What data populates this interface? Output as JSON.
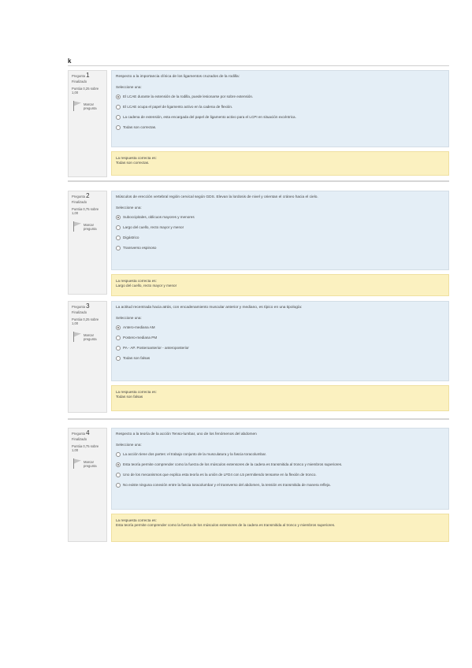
{
  "page_mark": "k",
  "flag_label": "Marcar pregunta",
  "prompt": "Seleccione una:",
  "questions": [
    {
      "label": "Pregunta",
      "number": "1",
      "state": "Finalizado",
      "grade": "Puntúa 0,25 sobre 1,00",
      "text": "Respecto a la importancia clínica de los ligamentos cruzados de la rodilla:",
      "options": [
        {
          "text": "El LCAE durante la extensión de la rodilla, puede lesionarse por sobre extensión.",
          "checked": true
        },
        {
          "text": "El LCAE ocupa el papel de ligamento activo en la cadena de flexión.",
          "checked": false
        },
        {
          "text": "La cadena de extensión, esta encargada del papel de ligamento activo para el LCPI en situación excéntrica.",
          "checked": false
        },
        {
          "text": "Todas son correctas.",
          "checked": false
        }
      ],
      "feedback_title": "La respuesta correcta es:",
      "feedback_answer": "Todas son correctas."
    },
    {
      "label": "Pregunta",
      "number": "2",
      "state": "Finalizado",
      "grade": "Puntúa 0,75 sobre 1,00",
      "text": "Músculos de erección vertebral región cervical según GDS. Elevan la lordosis de nivel y orientan el cráneo hacia el cielo.",
      "options": [
        {
          "text": "Suboccipitales, oblicuos mayores y menores",
          "checked": true
        },
        {
          "text": "Largo del cuello, recto mayor y menor",
          "checked": false
        },
        {
          "text": "Digástrico",
          "checked": false
        },
        {
          "text": "Transverso espinoso",
          "checked": false
        }
      ],
      "feedback_title": "La respuesta correcta es:",
      "feedback_answer": "Largo del cuello, recto mayor y menor"
    },
    {
      "label": "Pregunta",
      "number": "3",
      "state": "Finalizado",
      "grade": "Puntúa 0,25 sobre 1,00",
      "text": "La actitud recentrada hacia atrás, con encadenamiento muscular anterior y mediano, es típico en una tipología:",
      "options": [
        {
          "text": "Antero-mediana AM",
          "checked": true
        },
        {
          "text": "Postero-mediana PM",
          "checked": false
        },
        {
          "text": "PA - AP. Posteroanterior - anteroposterior",
          "checked": false
        },
        {
          "text": "Todas son falsas",
          "checked": false
        }
      ],
      "feedback_title": "La respuesta correcta es:",
      "feedback_answer": "Todas son falsas"
    },
    {
      "label": "Pregunta",
      "number": "4",
      "state": "Finalizado",
      "grade": "Puntúa 0,75 sobre 1,00",
      "text": "Respecto a la teoría de la acción Tenso-lumbar, uno de los fenómenos del abdomen",
      "options": [
        {
          "text": "La acción tiene dos partes: el trabajo conjunto de la musculatura y la fascia toracolumbar.",
          "checked": false
        },
        {
          "text": "Esta teoría permite comprender como la fuerza de los músculos extensores de la cadera es transmitida al tronco y miembros superiores.",
          "checked": true
        },
        {
          "text": "Uno de los mecanismos que explica esta teoría es la unión de LFD4 con L5 permitiendo tensarse en la flexión de tronco.",
          "checked": false
        },
        {
          "text": "No existe ninguna conexión entre la fascia toracolumbar y el transverso del abdomen, la tensión es transmitida de manera refleja.",
          "checked": false
        }
      ],
      "feedback_title": "La respuesta correcta es:",
      "feedback_answer": "Esta teoría permite comprender como la fuerza de los músculos extensores de la cadera es transmitida al tronco y miembros superiores."
    }
  ]
}
